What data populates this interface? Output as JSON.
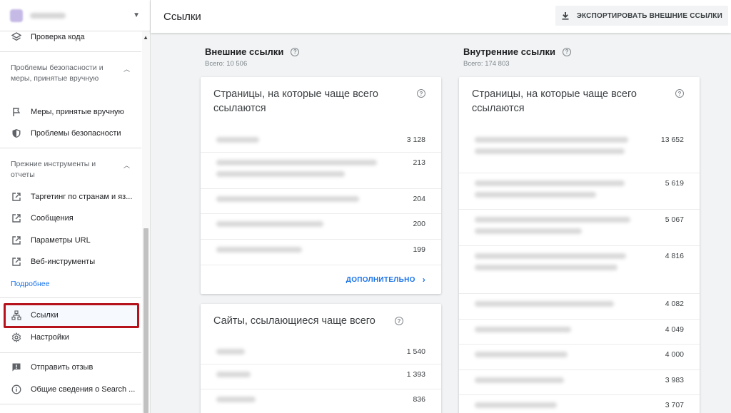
{
  "header": {
    "title": "Ссылки",
    "export_label": "ЭКСПОРТИРОВАТЬ ВНЕШНИЕ ССЫЛКИ"
  },
  "sidebar": {
    "code_check": "Проверка кода",
    "security_section": "Проблемы безопасности и меры, принятые вручную",
    "manual_actions": "Меры, принятые вручную",
    "security_issues": "Проблемы безопасности",
    "legacy_section": "Прежние инструменты и отчеты",
    "intl_targeting": "Таргетинг по странам и яз...",
    "messages": "Сообщения",
    "url_params": "Параметры URL",
    "web_tools": "Веб-инструменты",
    "more_link": "Подробнее",
    "links": "Ссылки",
    "settings": "Настройки",
    "feedback": "Отправить отзыв",
    "about": "Общие сведения о Search ..."
  },
  "external": {
    "heading": "Внешние ссылки",
    "total": "Всего: 10 506",
    "top_pages": {
      "title": "Страницы, на которые чаще всего ссылаются",
      "values": [
        "3 128",
        "213",
        "204",
        "200",
        "199"
      ],
      "more_label": "ДОПОЛНИТЕЛЬНО"
    },
    "top_sites": {
      "title": "Сайты, ссылающиеся чаще всего",
      "values": [
        "1 540",
        "1 393",
        "836"
      ]
    }
  },
  "internal": {
    "heading": "Внутренние ссылки",
    "total": "Всего: 174 803",
    "top_pages": {
      "title": "Страницы, на которые чаще всего ссылаются",
      "values": [
        "13 652",
        "5 619",
        "5 067",
        "4 816",
        "4 082",
        "4 049",
        "4 000",
        "3 983",
        "3 707"
      ]
    }
  },
  "colors": {
    "accent": "#1a73e8",
    "highlight_border": "#b5121b"
  }
}
